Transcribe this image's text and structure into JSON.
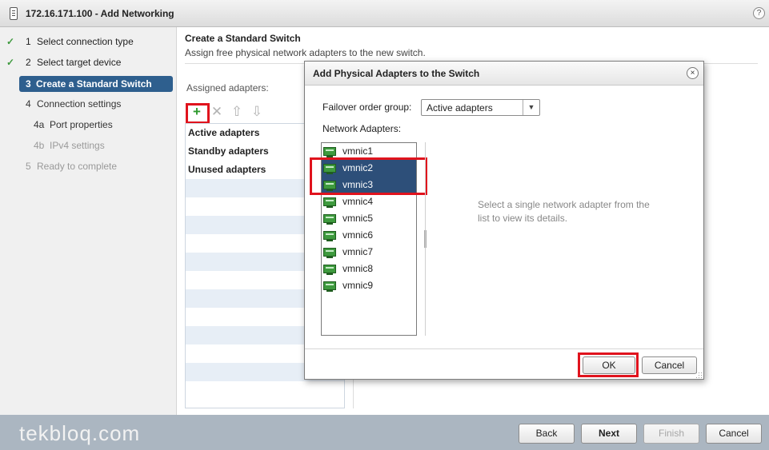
{
  "window": {
    "title": "172.16.171.100 - Add Networking",
    "help_label": "?"
  },
  "steps": [
    {
      "number": "1",
      "label": "Select connection type",
      "state": "done"
    },
    {
      "number": "2",
      "label": "Select target device",
      "state": "done"
    },
    {
      "number": "3",
      "label": "Create a Standard Switch",
      "state": "current"
    },
    {
      "number": "4",
      "label": "Connection settings",
      "state": "enabled"
    },
    {
      "number": "4a",
      "label": "Port properties",
      "state": "enabled"
    },
    {
      "number": "4b",
      "label": "IPv4 settings",
      "state": "disabled"
    },
    {
      "number": "5",
      "label": "Ready to complete",
      "state": "disabled"
    }
  ],
  "main": {
    "heading": "Create a Standard Switch",
    "subheading": "Assign free physical network adapters to the new switch.",
    "assigned_label": "Assigned adapters:",
    "toolbar": {
      "add_icon": "+",
      "remove_icon": "✕",
      "up_icon": "⇧",
      "down_icon": "⇩"
    },
    "adapter_groups": [
      "Active adapters",
      "Standby adapters",
      "Unused adapters"
    ]
  },
  "dialog": {
    "title": "Add Physical Adapters to the Switch",
    "close_label": "×",
    "failover_label": "Failover order group:",
    "failover_value": "Active adapters",
    "failover_arrow": "▼",
    "network_adapters_label": "Network Adapters:",
    "nics": [
      {
        "name": "vmnic1",
        "selected": false
      },
      {
        "name": "vmnic2",
        "selected": true
      },
      {
        "name": "vmnic3",
        "selected": true
      },
      {
        "name": "vmnic4",
        "selected": false
      },
      {
        "name": "vmnic5",
        "selected": false
      },
      {
        "name": "vmnic6",
        "selected": false
      },
      {
        "name": "vmnic7",
        "selected": false
      },
      {
        "name": "vmnic8",
        "selected": false
      },
      {
        "name": "vmnic9",
        "selected": false
      }
    ],
    "details_text": "Select a single network adapter from the list to view its details.",
    "ok_label": "OK",
    "cancel_label": "Cancel"
  },
  "footer": {
    "watermark": "tekbloq.com",
    "back_label": "Back",
    "next_label": "Next",
    "finish_label": "Finish",
    "cancel_label": "Cancel"
  },
  "colors": {
    "highlight_red": "#e0131d",
    "current_step": "#2e5f8e",
    "selected_row": "#2d4f79",
    "footer_bg": "#abb6c1"
  }
}
